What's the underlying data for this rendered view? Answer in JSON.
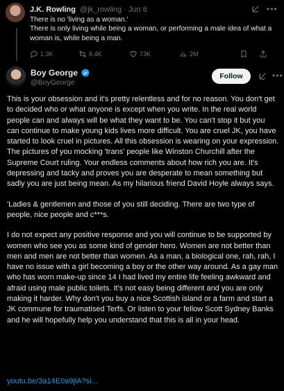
{
  "parent_post": {
    "author_name": "J.K. Rowling",
    "handle_time": "@jk_rowling · Jun 6",
    "lines": [
      "There is no 'living as a woman.'",
      "There is only living while being a woman, or performing a male idea of what a woman is, while being a man."
    ],
    "actions": {
      "replies": "1.3K",
      "reposts": "8.4K",
      "likes": "73K",
      "views": "2M"
    }
  },
  "reply_post": {
    "author_name": "Boy George",
    "handle": "@BoyGeorge",
    "follow_label": "Follow",
    "paragraphs": [
      "This is your obsession and it's pretty relentless and for no reason. You don't get to decided who or what anyone is except when you write. In the real world people can and always will be what they want to be. You can't stop it but you can continue to make young kids lives more difficult. You are cruel JK, you have started to look cruel in pictures. All this obsession is wearing on your expression. The pictures of you mocking 'trans' people like Winston Churchill after the Supreme Court ruling. Your endless comments about how rich you are. It's depressing and tacky and proves you are desperate to mean something but sadly you are just being mean. As my hilarious friend David Hoyle always says.",
      "'Ladies & gentlemen and those of you still deciding. There are two type of people, nice people and c***s.",
      "I do not expect any positive response and you will continue to be supported by women who see you as some kind of gender hero. Women are not better than men and men are not better than women. As a man, a biological one, rah, rah, I have no issue with a  girl becoming a boy or the other way around. As a gay man who has worn make-up since 14 I had lived my entire life feeling awkward and afraid using male public toilets. It's not easy being different and you are only making it harder. Why don't you buy a nice Scottish island or a farm and start a JK commune for traumatised Terfs. Or listen to your fellow Scott Sydney Banks and he will hopefully help you understand that this is all in your head."
    ],
    "link_text": "youtu.be/3a14E0a9jlA?si..."
  },
  "colors": {
    "background": "#000000",
    "text": "#e7e9ea",
    "muted": "#71767b",
    "accent": "#1d9bf0"
  }
}
